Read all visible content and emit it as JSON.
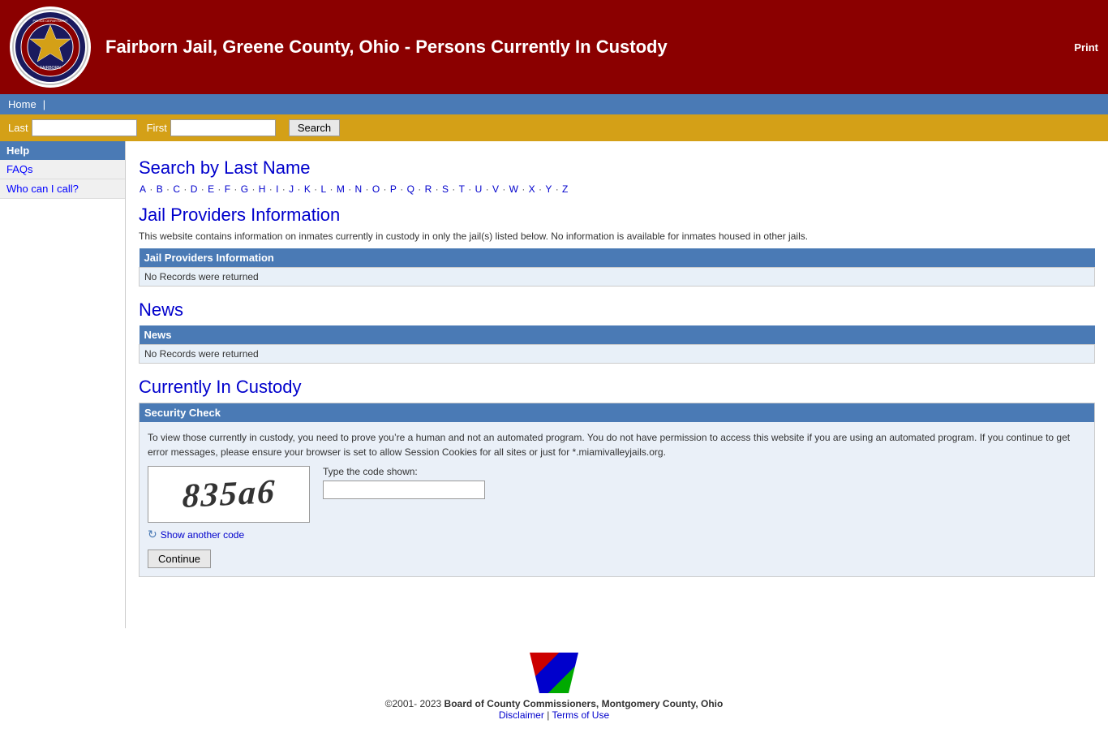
{
  "header": {
    "title": "Fairborn Jail, Greene County, Ohio - Persons Currently In Custody",
    "print_label": "Print"
  },
  "navbar": {
    "home_label": "Home",
    "separator": "|"
  },
  "searchbar": {
    "last_label": "Last",
    "first_label": "First",
    "search_label": "Search",
    "last_placeholder": "",
    "first_placeholder": ""
  },
  "sidebar": {
    "help_label": "Help",
    "faqs_label": "FAQs",
    "who_label": "Who can I call?"
  },
  "search_section": {
    "title": "Search by Last Name",
    "alpha": [
      "A",
      "B",
      "C",
      "D",
      "E",
      "F",
      "G",
      "H",
      "I",
      "J",
      "K",
      "L",
      "M",
      "N",
      "O",
      "P",
      "Q",
      "R",
      "S",
      "T",
      "U",
      "V",
      "W",
      "X",
      "Y",
      "Z"
    ]
  },
  "jail_providers": {
    "title": "Jail Providers Information",
    "description": "This website contains information on inmates currently in custody in only the jail(s) listed below. No information is available for inmates housed in other jails.",
    "table_header": "Jail Providers Information",
    "table_empty": "No Records were returned"
  },
  "news": {
    "title": "News",
    "table_header": "News",
    "table_empty": "No Records were returned"
  },
  "custody": {
    "title": "Currently In Custody"
  },
  "security": {
    "header": "Security Check",
    "description": "To view those currently in custody, you need to prove you’re a human and not an automated program. You do not have permission to access this website if you are using an automated program. If you continue to get error messages, please ensure your browser is set to allow Session Cookies for all sites or just for *.miamivalleyjails.org.",
    "captcha_value": "835a6",
    "type_label": "Type the code shown:",
    "refresh_label": "Show another code",
    "continue_label": "Continue"
  },
  "footer": {
    "copyright": "©2001- 2023",
    "board": "Board of County Commissioners, Montgomery County, Ohio",
    "disclaimer_label": "Disclaimer",
    "separator": "|",
    "terms_label": "Terms of Use"
  }
}
